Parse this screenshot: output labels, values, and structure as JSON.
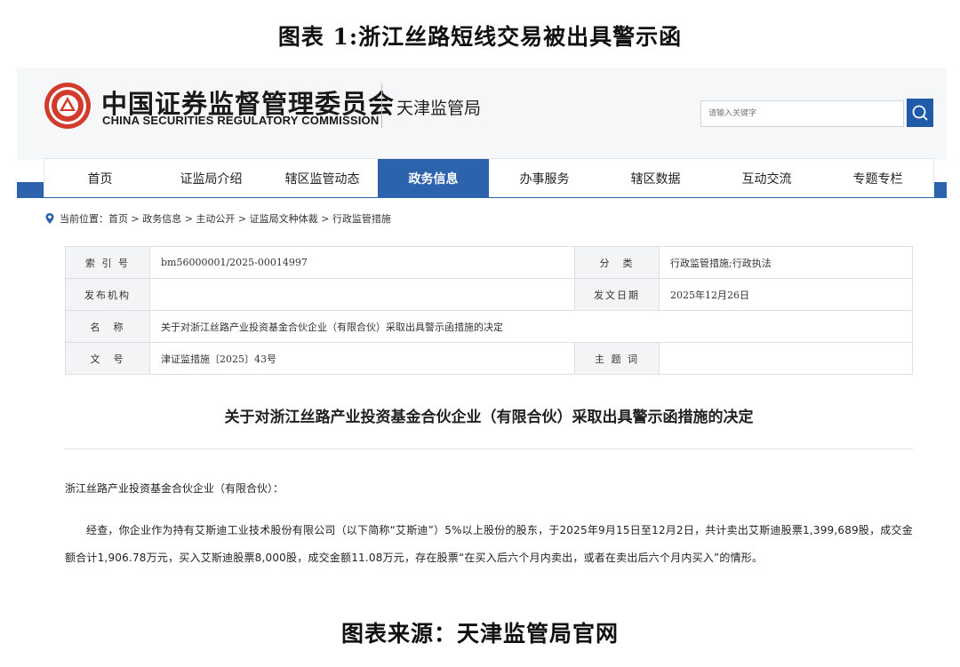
{
  "figure": {
    "title": "图表 1:浙江丝路短线交易被出具警示函",
    "source": "图表来源：天津监管局官网"
  },
  "header": {
    "org_name_cn": "中国证券监督管理委员会",
    "org_name_en": "CHINA SECURITIES REGULATORY COMMISSION",
    "bureau": "天津监管局",
    "search_placeholder": "请输入关键字"
  },
  "nav": {
    "items": [
      {
        "label": "首页"
      },
      {
        "label": "证监局介绍"
      },
      {
        "label": "辖区监管动态"
      },
      {
        "label": "政务信息",
        "active": true
      },
      {
        "label": "办事服务"
      },
      {
        "label": "辖区数据"
      },
      {
        "label": "互动交流"
      },
      {
        "label": "专题专栏"
      }
    ]
  },
  "breadcrumb": "当前位置：首页 > 政务信息 > 主动公开 > 证监局文种体裁 > 行政监管措施",
  "info_table": {
    "index_label": "索 引 号",
    "index_value": "bm56000001/2025-00014997",
    "category_label": "分　类",
    "category_value": "行政监管措施;行政执法",
    "publisher_label": "发布机构",
    "publisher_value": "",
    "date_label": "发文日期",
    "date_value": "2025年12月26日",
    "name_label": "名　称",
    "name_value": "关于对浙江丝路产业投资基金合伙企业（有限合伙）采取出具警示函措施的决定",
    "doc_no_label": "文　号",
    "doc_no_value": "津证监措施〔2025〕43号",
    "subject_label": "主 题 词",
    "subject_value": ""
  },
  "document": {
    "title": "关于对浙江丝路产业投资基金合伙企业（有限合伙）采取出具警示函措施的决定",
    "addressee": "浙江丝路产业投资基金合伙企业（有限合伙）：",
    "paragraph": "经查，你企业作为持有艾斯迪工业技术股份有限公司（以下简称“艾斯迪”）5%以上股份的股东，于2025年9月15日至12月2日，共计卖出艾斯迪股票1,399,689股，成交金额合计1,906.78万元，买入艾斯迪股票8,000股，成交金额11.08万元，存在股票“在买入后六个月内卖出，或者在卖出后六个月内买入”的情形。"
  },
  "colors": {
    "nav_blue": "#2d63ad",
    "emblem_red": "#d23a2c"
  }
}
